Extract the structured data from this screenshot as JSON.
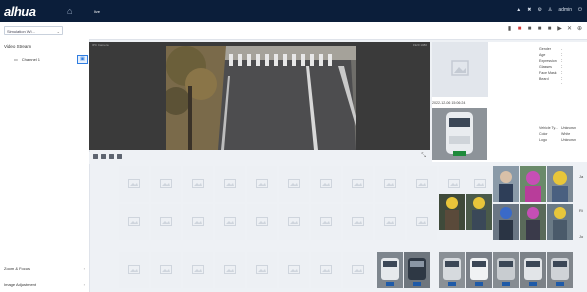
{
  "topbar": {
    "brand": "alhua",
    "nav_label": "live",
    "user": "admin",
    "icons": [
      "home-icon",
      "bell-icon",
      "settings-icon",
      "user-icon",
      "gear-icon"
    ]
  },
  "subbar": {
    "device_select": "Simulation Wi...",
    "toolbar_icons": [
      "record-icon",
      "snapshot-icon",
      "playback-icon",
      "fullscreen-icon",
      "layout-icon",
      "audio-icon",
      "close-icon",
      "zoom-icon"
    ]
  },
  "left_panel": {
    "title": "Video Stream",
    "channel_label": "Channel 1",
    "zoom_focus": "Zoom & Focus",
    "image_adjustment": "Image Adjustment"
  },
  "video": {
    "camera_label": "IPC Camera",
    "ratio_label": "1920 1080"
  },
  "face_panel": {
    "gender_label": "Gender",
    "gender_value": "--",
    "age_label": "Age",
    "age_value": "--",
    "expression_label": "Expression",
    "expression_value": "--",
    "glasses_label": "Glasses",
    "glasses_value": "--",
    "mask_label": "Face Mask",
    "mask_value": "--",
    "beard_label": "Beard",
    "beard_value": "--"
  },
  "vehicle_panel": {
    "timestamp": "2022-12-06 15:06:24",
    "type_label": "Vehicle Ty...",
    "type_value": "Unknown",
    "color_label": "Color",
    "color_value": "White",
    "logo_label": "Logo",
    "logo_value": "Unknown"
  },
  "side_cut": {
    "a": "Ja",
    "b": "Ri",
    "c": "Jo"
  },
  "colors": {
    "topbar": "#0b1e3a",
    "accent": "#2f7de1",
    "record": "#d23a3a"
  }
}
